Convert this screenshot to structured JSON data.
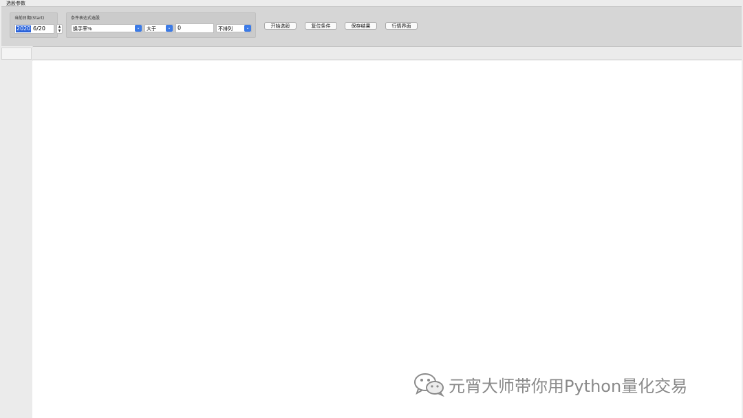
{
  "window": {
    "title": "选股参数"
  },
  "date_group": {
    "label": "当前日期(Start)",
    "year": "2020",
    "rest": "6/20"
  },
  "condition_group": {
    "label": "条件表达式选股",
    "indicator": "换手率%",
    "operator": "大于",
    "value": "0",
    "sort": "不排列"
  },
  "buttons": {
    "start": "开始选股",
    "reset": "复位条件",
    "save": "保存结果",
    "market": "行情界面"
  },
  "watermark": {
    "text": "元宵大师带你用Python量化交易"
  },
  "colors": {
    "accent": "#2a62d9",
    "select_arrow": "#3b7ae6",
    "toolbar": "#d6d6d6",
    "main_bg": "#ffffff"
  }
}
